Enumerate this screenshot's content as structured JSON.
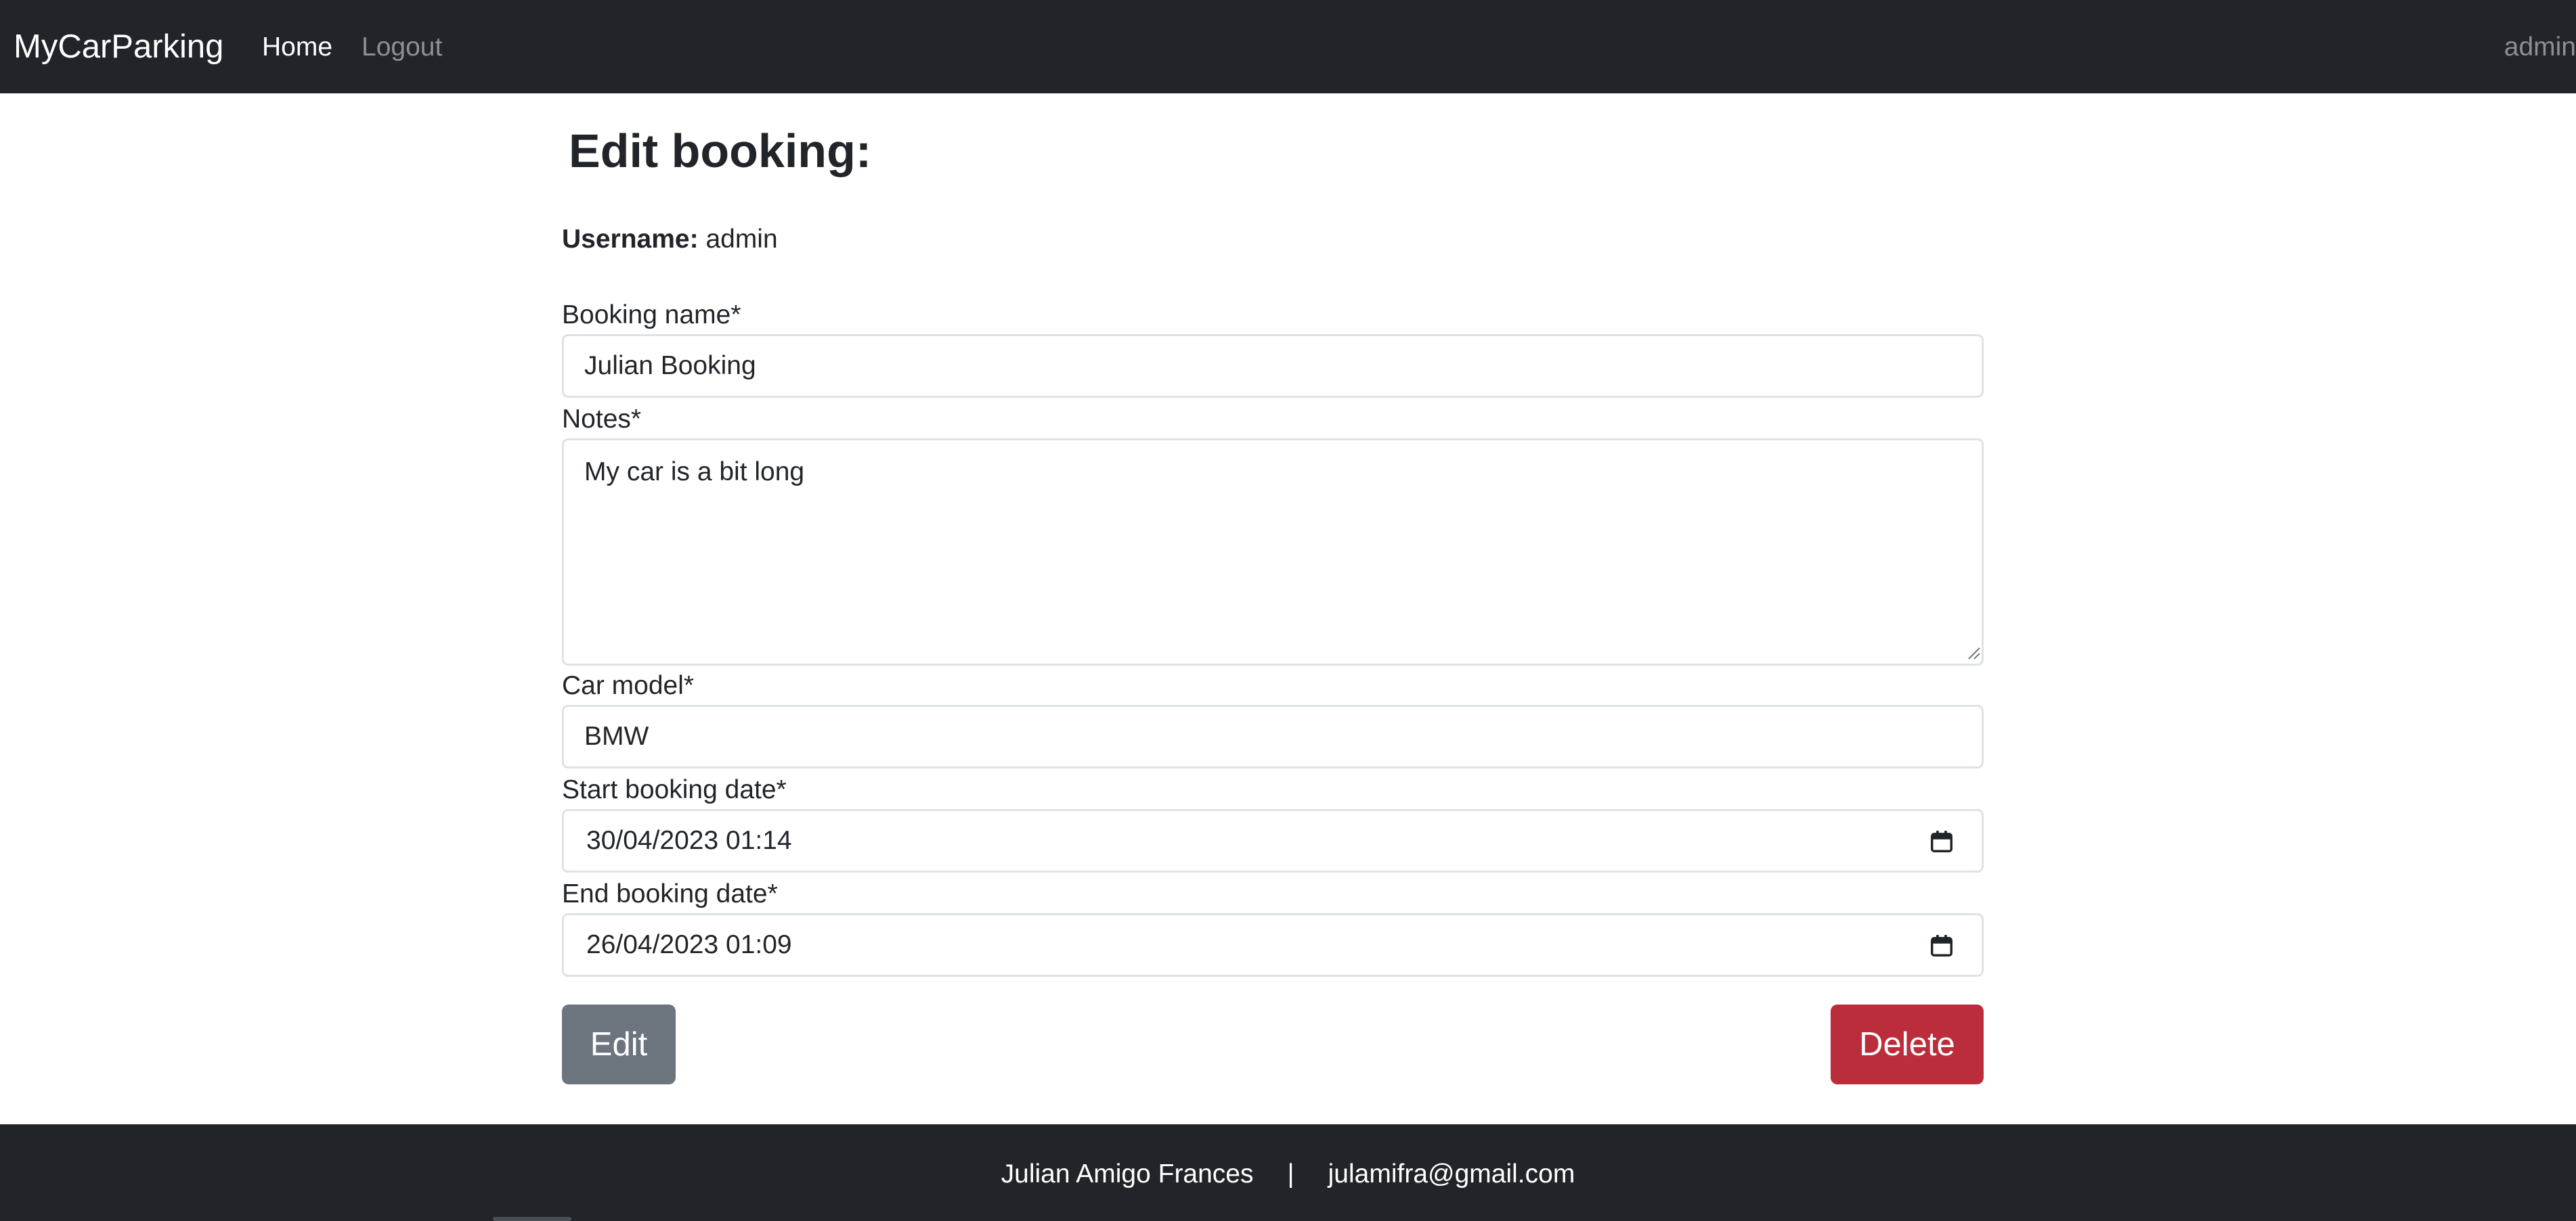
{
  "navbar": {
    "brand": "MyCarParking",
    "links": [
      {
        "label": "Home",
        "active": true
      },
      {
        "label": "Logout",
        "active": false
      }
    ],
    "user": "admin"
  },
  "page": {
    "title": "Edit booking:",
    "username_label": "Username:",
    "username_value": "admin"
  },
  "form": {
    "booking_name": {
      "label": "Booking name*",
      "value": "Julian Booking"
    },
    "notes": {
      "label": "Notes*",
      "value": "My car is a bit long"
    },
    "car_model": {
      "label": "Car model*",
      "value": "BMW"
    },
    "start_date": {
      "label": "Start booking date*",
      "value": "30/04/2023 01:14"
    },
    "end_date": {
      "label": "End booking date*",
      "value": "26/04/2023 01:09"
    },
    "edit_label": "Edit",
    "delete_label": "Delete"
  },
  "footer": {
    "name": "Julian Amigo Frances",
    "separator": "|",
    "email": "julamifra@gmail.com"
  },
  "colors": {
    "navbar_bg": "#212529",
    "edit_button": "#6c757d",
    "delete_button": "#bb2d3b",
    "input_border": "#dee2e6"
  },
  "icons": {
    "calendar": "calendar-icon"
  }
}
